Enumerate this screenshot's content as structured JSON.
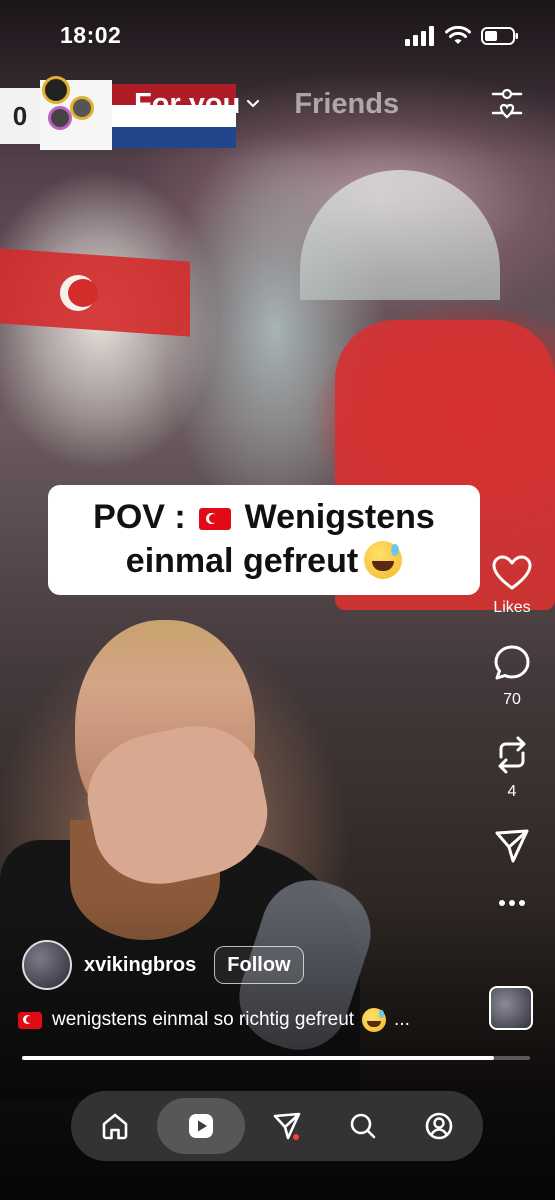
{
  "status_bar": {
    "time": "18:02"
  },
  "scoreboard": {
    "score": "0"
  },
  "tabs": {
    "for_you": "For you",
    "friends": "Friends"
  },
  "caption": {
    "line1_prefix": "POV :",
    "line1_suffix": "Wenigstens",
    "line2": "einmal gefreut"
  },
  "actions": {
    "likes_label": "Likes",
    "comments_count": "70",
    "reposts_count": "4"
  },
  "author": {
    "username": "xvikingbros",
    "follow_label": "Follow"
  },
  "description": {
    "text": "wenigstens einmal so richtig gefreut",
    "more": "..."
  },
  "playback": {
    "progress_fraction": 0.93
  },
  "colors": {
    "accent_dot": "#ff3b3b",
    "nl_red": "#ae1c28",
    "nl_white": "#ffffff",
    "nl_blue": "#21468b"
  },
  "nav": {
    "items": [
      {
        "icon": "home-icon"
      },
      {
        "icon": "play-icon",
        "active": true
      },
      {
        "icon": "send-icon",
        "badge": true
      },
      {
        "icon": "search-icon"
      },
      {
        "icon": "profile-icon"
      }
    ]
  }
}
